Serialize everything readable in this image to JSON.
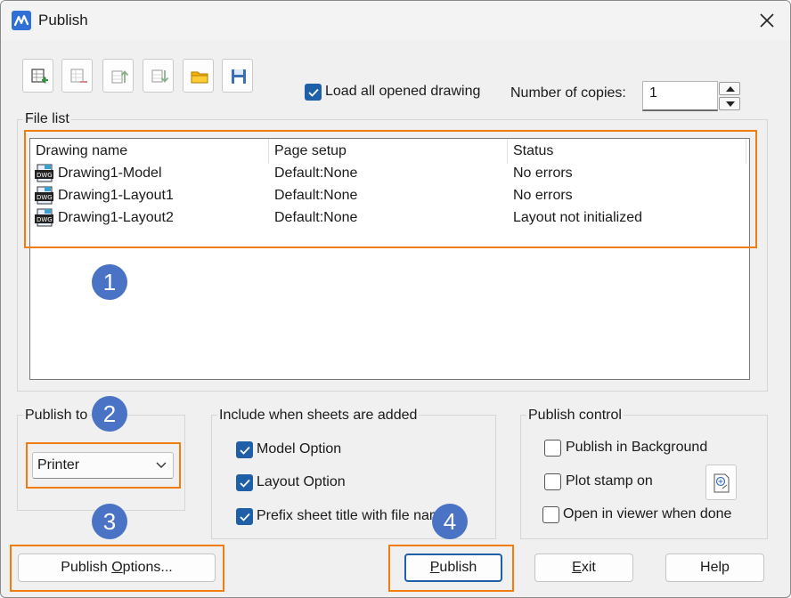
{
  "window": {
    "title": "Publish",
    "close_glyph": "✕"
  },
  "toolbar": {
    "buttons": [
      {
        "name": "add-sheets-icon"
      },
      {
        "name": "remove-sheets-icon"
      },
      {
        "name": "move-up-icon"
      },
      {
        "name": "move-down-icon"
      },
      {
        "name": "open-folder-icon"
      },
      {
        "name": "save-icon"
      }
    ],
    "load_all_label": "Load all opened drawing",
    "load_all_checked": true,
    "copies_label": "Number of copies:",
    "copies_value": "1"
  },
  "file_list": {
    "title": "File list",
    "columns": [
      "Drawing name",
      "Page setup",
      "Status"
    ],
    "rows": [
      {
        "name": "Drawing1-Model",
        "page_setup": "Default:None",
        "status": "No errors"
      },
      {
        "name": "Drawing1-Layout1",
        "page_setup": "Default:None",
        "status": "No errors"
      },
      {
        "name": "Drawing1-Layout2",
        "page_setup": "Default:None",
        "status": "Layout not initialized"
      }
    ]
  },
  "publish_to": {
    "title": "Publish to",
    "selected": "Printer"
  },
  "include": {
    "title": "Include when sheets are added",
    "options": [
      {
        "label": "Model Option",
        "checked": true
      },
      {
        "label": "Layout Option",
        "checked": true
      },
      {
        "label": "Prefix sheet title with file name",
        "checked": true
      }
    ]
  },
  "publish_control": {
    "title": "Publish control",
    "options": [
      {
        "label": "Publish in Background",
        "checked": false
      },
      {
        "label": "Plot stamp on",
        "checked": false
      },
      {
        "label": "Open in viewer when done",
        "checked": false
      }
    ]
  },
  "buttons": {
    "options_pre": "Publish ",
    "options_ul": "O",
    "options_post": "ptions...",
    "publish_ul": "P",
    "publish_post": "ublish",
    "exit_ul": "E",
    "exit_post": "xit",
    "help": "Help"
  },
  "callouts": [
    "1",
    "2",
    "3",
    "4"
  ],
  "colors": {
    "highlight": "#f07d0e",
    "badge": "#4a73c5",
    "check": "#1f5fa8"
  }
}
